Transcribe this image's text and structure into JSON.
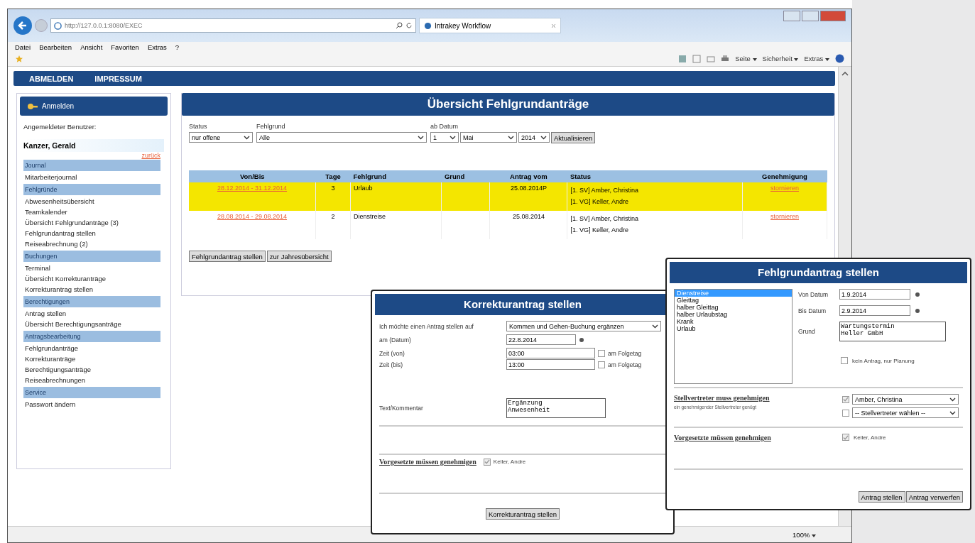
{
  "browser": {
    "url": "http://127.0.0.1:8080/EXEC",
    "tab_title": "Intrakey Workflow",
    "menu": [
      "Datei",
      "Bearbeiten",
      "Ansicht",
      "Favoriten",
      "Extras",
      "?"
    ],
    "command_bar": [
      "Seite",
      "Sicherheit",
      "Extras"
    ],
    "zoom": "100%"
  },
  "nav": [
    "ABMELDEN",
    "IMPRESSUM"
  ],
  "sidebar": {
    "header": "Anmelden",
    "user_label": "Angemeldeter Benutzer:",
    "user_name": "Kanzer, Gerald",
    "back_link": "zurück",
    "sections": [
      {
        "title": "Journal",
        "items": [
          "Mitarbeiterjournal"
        ]
      },
      {
        "title": "Fehlgründe",
        "items": [
          "Abwesenheitsübersicht",
          "Teamkalender",
          "Übersicht Fehlgrundanträge (3)",
          "Fehlgrundantrag stellen",
          "Reiseabrechnung (2)"
        ]
      },
      {
        "title": "Buchungen",
        "items": [
          "Terminal",
          "Übersicht Korrekturanträge",
          "Korrekturantrag stellen"
        ]
      },
      {
        "title": "Berechtigungen",
        "items": [
          "Antrag stellen",
          "Übersicht Berechtigungsanträge"
        ]
      },
      {
        "title": "Antragsbearbeitung",
        "items": [
          "Fehlgrundanträge",
          "Korrekturanträge",
          "Berechtigungsanträge",
          "Reiseabrechnungen"
        ]
      },
      {
        "title": "Service",
        "items": [
          "Passwort ändern"
        ]
      }
    ]
  },
  "main": {
    "title": "Übersicht Fehlgrundanträge",
    "filters": [
      {
        "label": "Status",
        "value": "nur offene"
      },
      {
        "label": "Fehlgrund",
        "value": "Alle"
      }
    ],
    "date_filter": {
      "label": "ab Datum",
      "day": "1",
      "month": "Mai",
      "year": "2014"
    },
    "refresh_button": "Aktualisieren",
    "columns": [
      "Von/Bis",
      "Tage",
      "Fehlgrund",
      "Grund",
      "Antrag vom",
      "Status",
      "Genehmigung"
    ],
    "rows": [
      {
        "highlighted": true,
        "period": "28.12.2014 - 31.12.2014",
        "days": "3",
        "reason_type": "Urlaub",
        "antrag_vom": "25.08.2014P",
        "status": [
          "[1. SV] Amber, Christina",
          "[1. VG] Keller, Andre"
        ],
        "action": "stornieren"
      },
      {
        "highlighted": false,
        "period": "28.08.2014 - 29.08.2014",
        "days": "2",
        "reason_type": "Dienstreise",
        "antrag_vom": "25.08.2014",
        "status": [
          "[1. SV] Amber, Christina",
          "[1. VG] Keller, Andre"
        ],
        "action": "stornieren"
      }
    ],
    "buttons": [
      "Fehlgrundantrag stellen",
      "zur Jahresübersicht"
    ]
  },
  "korrektur": {
    "title": "Korrekturantrag stellen",
    "type_label": "Ich möchte einen Antrag stellen auf",
    "type_value": "Kommen und Gehen-Buchung ergänzen",
    "date_label": "am (Datum)",
    "date_value": "22.8.2014",
    "times": [
      {
        "label": "Zeit (von)",
        "value": "03:00",
        "next_day_label": "am Folgetag",
        "next_day": false
      },
      {
        "label": "Zeit (bis)",
        "value": "13:00",
        "next_day_label": "am Folgetag",
        "next_day": false
      }
    ],
    "comment_label": "Text/Kommentar",
    "comment_value": "Ergänzung\nAnwesenheit",
    "approvers_label": "Vorgesetzte müssen genehmigen",
    "approvers": [
      {
        "name": "Keller, Andre",
        "checked": true
      }
    ],
    "submit": "Korrekturantrag stellen"
  },
  "fehlgrund": {
    "title": "Fehlgrundantrag stellen",
    "options": [
      {
        "label": "Dienstreise",
        "selected": true
      },
      {
        "label": "Gleittag",
        "selected": false
      },
      {
        "label": "halber Gleittag",
        "selected": false
      },
      {
        "label": "halber Urlaubstag",
        "selected": false
      },
      {
        "label": "Krank",
        "selected": false
      },
      {
        "label": "Urlaub",
        "selected": false
      }
    ],
    "from_label": "Von Datum",
    "from_value": "1.9.2014",
    "to_label": "Bis Datum",
    "to_value": "2.9.2014",
    "reason_label": "Grund",
    "reason_value": "Wartungstermin\nHeller GmbH",
    "plan_only_label": "kein Antrag, nur Planung",
    "plan_only": false,
    "deputies_label": "Stellvertreter muss genehmigen",
    "deputies_note": "ein genehmigender Stellvertreter genügt",
    "deputies": [
      {
        "value": "Amber, Christina",
        "checked": true
      },
      {
        "value": "-- Stellvertreter wählen --",
        "checked": false
      }
    ],
    "supervisors_label": "Vorgesetzte müssen genehmigen",
    "supervisors": [
      {
        "name": "Keller, Andre",
        "checked": true
      }
    ],
    "buttons": [
      "Antrag stellen",
      "Antrag verwerfen"
    ]
  }
}
